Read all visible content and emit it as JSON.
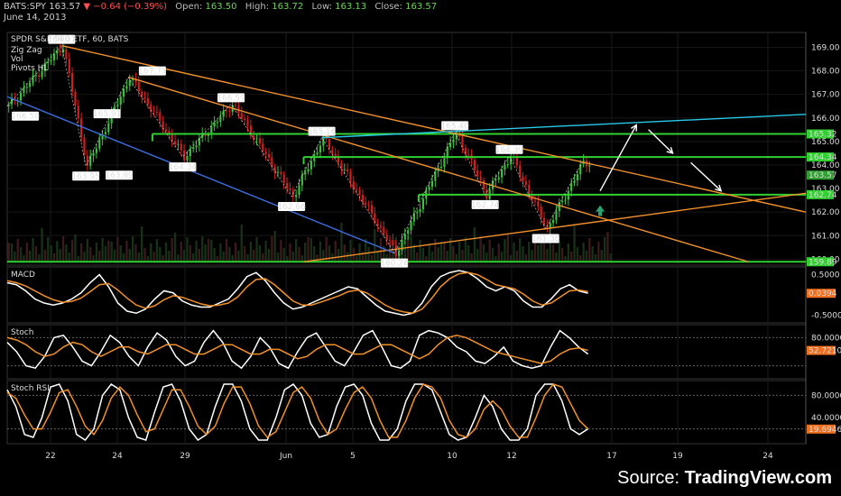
{
  "header": {
    "symbol": "BATS:SPY",
    "last": "163.57",
    "change": "−0.64 (−0.39%)",
    "open_label": "Open:",
    "open": "163.50",
    "high_label": "High:",
    "high": "163.72",
    "low_label": "Low:",
    "low": "163.13",
    "close_label": "Close:",
    "close": "163.57",
    "date": "June 14, 2013"
  },
  "source": {
    "prefix": "Source: ",
    "brand": "TradingView.com"
  },
  "chart_data": [
    {
      "type": "candlestick",
      "title": "SPDR S&P 500 ETF, 60, BATS",
      "indicators": [
        "Zig Zag",
        "Vol",
        "Pivots HL"
      ],
      "ylim": [
        159.9,
        169.4
      ],
      "yticks": [
        "169.00",
        "168.00",
        "167.00",
        "166.00",
        "165.00",
        "164.00",
        "163.00",
        "162.00",
        "161.00",
        "160.00"
      ],
      "xticks": [
        "22",
        "24",
        "29",
        "Jun",
        "5",
        "10",
        "12",
        "17",
        "19",
        "24"
      ],
      "zigzag": [
        {
          "x": 0,
          "y": 166.5
        },
        {
          "x": 18,
          "y": 169.07
        },
        {
          "x": 26,
          "y": 163.95
        },
        {
          "x": 40,
          "y": 167.73
        },
        {
          "x": 58,
          "y": 164.34
        },
        {
          "x": 74,
          "y": 166.59
        },
        {
          "x": 94,
          "y": 162.66
        },
        {
          "x": 104,
          "y": 165.16
        },
        {
          "x": 128,
          "y": 160.26
        },
        {
          "x": 148,
          "y": 165.4
        },
        {
          "x": 158,
          "y": 162.74
        },
        {
          "x": 166,
          "y": 164.39
        },
        {
          "x": 178,
          "y": 161.3
        },
        {
          "x": 190,
          "y": 164.1
        }
      ],
      "pivot_labels": [
        {
          "x": 6,
          "y": 166.5,
          "text": "166.50",
          "pos": "below"
        },
        {
          "x": 18,
          "y": 169.07,
          "text": "169.07",
          "pos": "above"
        },
        {
          "x": 26,
          "y": 163.95,
          "text": "163.95",
          "pos": "below"
        },
        {
          "x": 33,
          "y": 165.91,
          "text": "165.91",
          "pos": "above"
        },
        {
          "x": 37,
          "y": 163.99,
          "text": "163.99",
          "pos": "below"
        },
        {
          "x": 48,
          "y": 167.73,
          "text": "167.73",
          "pos": "above"
        },
        {
          "x": 58,
          "y": 164.34,
          "text": "164.34",
          "pos": "below"
        },
        {
          "x": 74,
          "y": 166.59,
          "text": "166.59",
          "pos": "above"
        },
        {
          "x": 94,
          "y": 162.66,
          "text": "162.66",
          "pos": "below"
        },
        {
          "x": 104,
          "y": 165.16,
          "text": "165.16",
          "pos": "above"
        },
        {
          "x": 128,
          "y": 160.26,
          "text": "160.26",
          "pos": "below"
        },
        {
          "x": 148,
          "y": 165.4,
          "text": "165.40",
          "pos": "above"
        },
        {
          "x": 158,
          "y": 162.74,
          "text": "162.74",
          "pos": "below"
        },
        {
          "x": 166,
          "y": 164.39,
          "text": "164.39",
          "pos": "above"
        },
        {
          "x": 178,
          "y": 161.3,
          "text": "161.30",
          "pos": "below"
        }
      ],
      "horizontal_levels": [
        {
          "value": 165.32,
          "label": "165.32",
          "from": 48
        },
        {
          "value": 164.34,
          "label": "164.34",
          "from": 98
        },
        {
          "value": 162.74,
          "label": "162.74",
          "from": 136
        },
        {
          "value": 159.89,
          "label": "159.89",
          "from": 0
        }
      ],
      "last_price": {
        "value": 163.57,
        "label": "163.57"
      },
      "trendlines": [
        {
          "color": "#f0902a",
          "x1": 18,
          "y1": 169.07,
          "x2": 264,
          "y2": 162.0
        },
        {
          "color": "#f0902a",
          "x1": 40,
          "y1": 167.73,
          "x2": 245,
          "y2": 159.89
        },
        {
          "color": "#f0902a",
          "x1": 98,
          "y1": 159.89,
          "x2": 264,
          "y2": 162.8
        },
        {
          "color": "#3b6fe0",
          "x1": 0,
          "y1": 166.9,
          "x2": 128,
          "y2": 160.26
        },
        {
          "color": "#29c9e8",
          "x1": 104,
          "y1": 165.16,
          "x2": 264,
          "y2": 166.15
        }
      ],
      "projection_arrows": [
        {
          "x1": 196,
          "y1": 162.9,
          "x2": 208,
          "y2": 165.7
        },
        {
          "x1": 212,
          "y1": 165.5,
          "x2": 220,
          "y2": 164.5
        },
        {
          "x1": 226,
          "y1": 164.1,
          "x2": 236,
          "y2": 162.9
        }
      ],
      "up_marker": {
        "x": 196,
        "y": 162.1
      }
    },
    {
      "type": "line",
      "title": "MACD",
      "ylim": [
        -0.6,
        0.6
      ],
      "yticks": [
        "0.5000",
        "-0.5000"
      ],
      "last_label": "0.0394",
      "series": [
        {
          "name": "MACD",
          "color": "#ffffff",
          "values": [
            0.3,
            0.25,
            0.1,
            -0.1,
            -0.2,
            -0.25,
            -0.2,
            -0.1,
            0.05,
            0.3,
            0.5,
            0.2,
            -0.2,
            -0.4,
            -0.45,
            -0.35,
            -0.1,
            0.1,
            0.05,
            -0.15,
            -0.25,
            -0.3,
            -0.3,
            -0.2,
            -0.1,
            0.15,
            0.45,
            0.55,
            0.35,
            0.05,
            -0.2,
            -0.35,
            -0.3,
            -0.2,
            -0.1,
            0.0,
            0.1,
            0.2,
            0.15,
            -0.05,
            -0.25,
            -0.4,
            -0.45,
            -0.5,
            -0.45,
            -0.2,
            0.2,
            0.45,
            0.55,
            0.6,
            0.55,
            0.4,
            0.2,
            0.1,
            0.2,
            0.1,
            -0.15,
            -0.3,
            -0.3,
            -0.1,
            0.15,
            0.25,
            0.1,
            0.04
          ]
        },
        {
          "name": "Signal",
          "color": "#f0902a",
          "values": [
            0.35,
            0.3,
            0.22,
            0.1,
            -0.02,
            -0.12,
            -0.18,
            -0.16,
            -0.08,
            0.08,
            0.25,
            0.28,
            0.12,
            -0.08,
            -0.25,
            -0.33,
            -0.27,
            -0.12,
            -0.02,
            -0.06,
            -0.14,
            -0.22,
            -0.27,
            -0.25,
            -0.2,
            -0.05,
            0.2,
            0.38,
            0.4,
            0.25,
            0.05,
            -0.15,
            -0.25,
            -0.25,
            -0.18,
            -0.1,
            -0.02,
            0.08,
            0.12,
            0.05,
            -0.1,
            -0.25,
            -0.36,
            -0.42,
            -0.45,
            -0.35,
            -0.1,
            0.2,
            0.4,
            0.52,
            0.55,
            0.5,
            0.38,
            0.25,
            0.2,
            0.15,
            0.02,
            -0.15,
            -0.25,
            -0.2,
            -0.05,
            0.1,
            0.12,
            0.08
          ]
        }
      ]
    },
    {
      "type": "line",
      "title": "Stoch",
      "ylim": [
        0,
        100
      ],
      "yticks": [
        "80.0000"
      ],
      "levels": [
        80,
        20
      ],
      "last_label": "52.7210",
      "series": [
        {
          "name": "%K",
          "color": "#ffffff",
          "values": [
            70,
            50,
            20,
            15,
            40,
            80,
            85,
            60,
            30,
            20,
            50,
            85,
            70,
            40,
            20,
            60,
            90,
            75,
            40,
            20,
            30,
            70,
            95,
            70,
            30,
            15,
            40,
            80,
            60,
            25,
            15,
            50,
            80,
            90,
            60,
            30,
            20,
            50,
            85,
            95,
            60,
            20,
            15,
            30,
            85,
            95,
            90,
            80,
            60,
            50,
            30,
            25,
            40,
            60,
            30,
            20,
            15,
            20,
            60,
            95,
            80,
            60,
            45
          ]
        },
        {
          "name": "%D",
          "color": "#f0902a",
          "values": [
            80,
            75,
            65,
            50,
            40,
            45,
            60,
            70,
            65,
            50,
            40,
            50,
            60,
            60,
            50,
            45,
            55,
            65,
            65,
            55,
            45,
            45,
            55,
            65,
            65,
            55,
            45,
            45,
            55,
            55,
            45,
            35,
            40,
            55,
            65,
            65,
            55,
            45,
            45,
            55,
            65,
            65,
            55,
            45,
            35,
            45,
            65,
            80,
            85,
            80,
            70,
            60,
            50,
            45,
            40,
            35,
            30,
            25,
            30,
            45,
            55,
            58,
            53
          ]
        }
      ]
    },
    {
      "type": "line",
      "title": "Stoch RSI",
      "ylim": [
        0,
        100
      ],
      "yticks": [
        "80.0000",
        "40.0000"
      ],
      "levels": [
        80,
        20
      ],
      "last_label": "19.6946",
      "series": [
        {
          "name": "K",
          "color": "#ffffff",
          "values": [
            90,
            60,
            10,
            5,
            40,
            95,
            100,
            70,
            10,
            0,
            20,
            80,
            100,
            90,
            40,
            5,
            0,
            50,
            95,
            100,
            70,
            20,
            0,
            10,
            60,
            100,
            100,
            70,
            20,
            0,
            0,
            40,
            90,
            100,
            80,
            30,
            5,
            10,
            60,
            95,
            100,
            80,
            30,
            0,
            0,
            20,
            70,
            100,
            100,
            90,
            50,
            10,
            0,
            5,
            40,
            80,
            60,
            20,
            0,
            0,
            20,
            80,
            100,
            100,
            70,
            20,
            10,
            20
          ]
        },
        {
          "name": "D",
          "color": "#f0902a",
          "values": [
            85,
            75,
            45,
            20,
            20,
            50,
            85,
            90,
            60,
            25,
            10,
            35,
            75,
            95,
            80,
            45,
            15,
            20,
            55,
            90,
            90,
            60,
            25,
            10,
            25,
            65,
            95,
            95,
            65,
            25,
            5,
            15,
            50,
            85,
            95,
            75,
            35,
            10,
            20,
            55,
            85,
            95,
            75,
            35,
            5,
            5,
            35,
            75,
            100,
            95,
            75,
            35,
            10,
            5,
            20,
            55,
            70,
            55,
            25,
            5,
            5,
            40,
            80,
            100,
            95,
            65,
            35,
            20
          ]
        }
      ]
    }
  ]
}
